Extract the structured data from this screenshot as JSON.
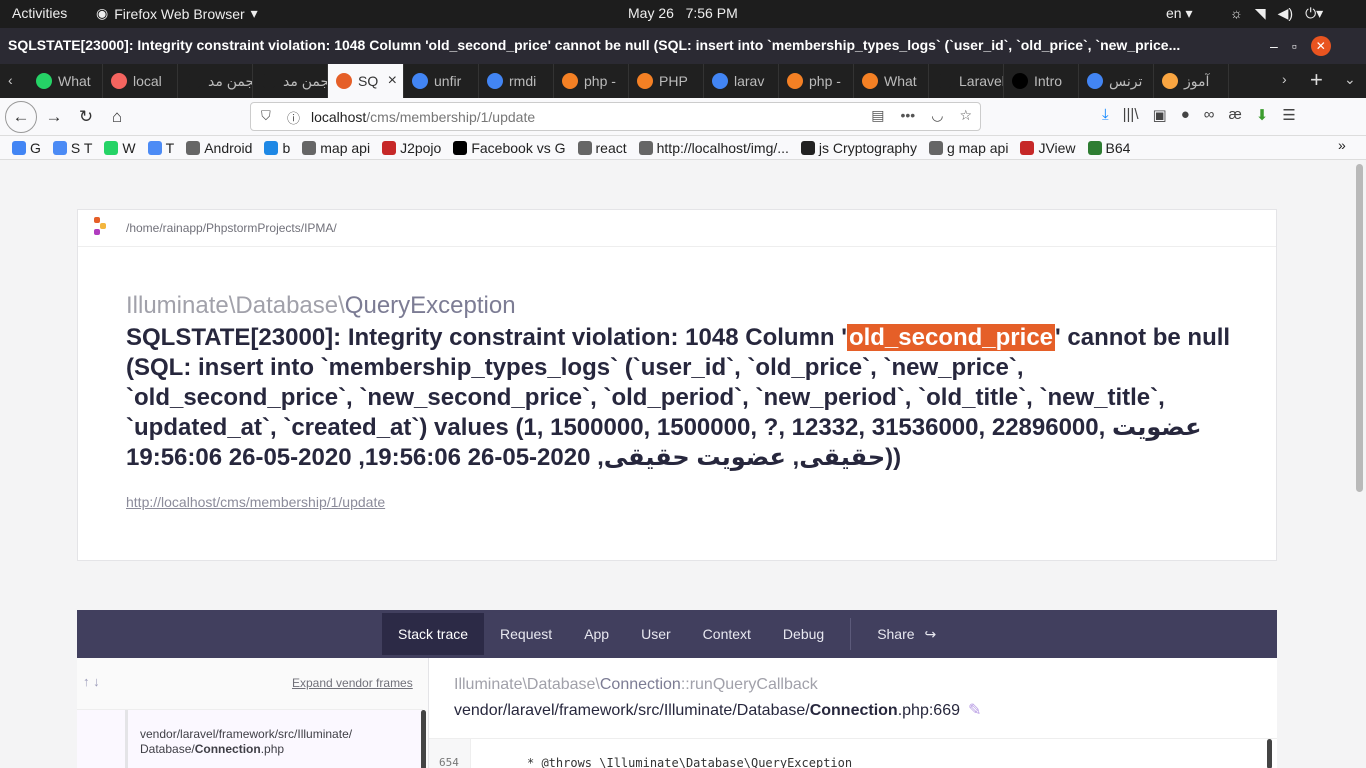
{
  "system": {
    "activities": "Activities",
    "app_name": "Firefox Web Browser",
    "date": "May 26",
    "time": "7:56 PM",
    "lang": "en"
  },
  "window": {
    "title": "SQLSTATE[23000]: Integrity constraint violation: 1048 Column 'old_second_price' cannot be null (SQL: insert into `membership_types_logs` (`user_id`, `old_price`, `new_price..."
  },
  "tabs": [
    {
      "label": "What",
      "icon": "whatsapp-icon",
      "color": "#25d366"
    },
    {
      "label": "local",
      "icon": "laravel-icon",
      "color": "#f4645f"
    },
    {
      "label": "انجمن مد",
      "icon": "blank-icon",
      "color": "#202020"
    },
    {
      "label": "انجمن مد",
      "icon": "blank-icon",
      "color": "#202020"
    },
    {
      "label": "SQ",
      "icon": "pencil-icon",
      "color": "#e55f28"
    },
    {
      "label": "unfir",
      "icon": "google-icon",
      "color": "#4285f4"
    },
    {
      "label": "rmdi",
      "icon": "google-icon",
      "color": "#4285f4"
    },
    {
      "label": "php -",
      "icon": "stackoverflow-icon",
      "color": "#f48024"
    },
    {
      "label": "PHP",
      "icon": "stackoverflow-icon",
      "color": "#f48024"
    },
    {
      "label": "larav",
      "icon": "google-icon",
      "color": "#4285f4"
    },
    {
      "label": "php -",
      "icon": "stackoverflow-icon",
      "color": "#f48024"
    },
    {
      "label": "What",
      "icon": "stackoverflow-icon",
      "color": "#f48024"
    },
    {
      "label": "Laravel-",
      "icon": "blank-icon",
      "color": "#202020"
    },
    {
      "label": "Intro",
      "icon": "medium-icon",
      "color": "#000000"
    },
    {
      "label": "ترنس",
      "icon": "google-icon",
      "color": "#4285f4"
    },
    {
      "label": "آموز",
      "icon": "joomla-icon",
      "color": "#f9a541"
    }
  ],
  "url": {
    "host": "localhost",
    "path": "/cms/membership/1/update"
  },
  "bookmarks": [
    {
      "label": "G",
      "icon": "google-icon",
      "color": "#4285f4"
    },
    {
      "label": "S T",
      "icon": "translate-icon",
      "color": "#4c8bf5"
    },
    {
      "label": "W",
      "icon": "whatsapp-icon",
      "color": "#25d366"
    },
    {
      "label": "T",
      "icon": "translate-icon",
      "color": "#4c8bf5"
    },
    {
      "label": "Android",
      "icon": "folder-icon",
      "color": "#666666"
    },
    {
      "label": "b",
      "icon": "bootstrap-icon",
      "color": "#1e88e5"
    },
    {
      "label": "map api",
      "icon": "folder-icon",
      "color": "#666666"
    },
    {
      "label": "J2pojo",
      "icon": "json-icon",
      "color": "#c62828"
    },
    {
      "label": "Facebook vs G",
      "icon": "medium-icon",
      "color": "#000000"
    },
    {
      "label": "react",
      "icon": "folder-icon",
      "color": "#666666"
    },
    {
      "label": "http://localhost/img/...",
      "icon": "globe-icon",
      "color": "#666666"
    },
    {
      "label": "js Cryptography",
      "icon": "github-icon",
      "color": "#222222"
    },
    {
      "label": "g map api",
      "icon": "globe-icon",
      "color": "#666666"
    },
    {
      "label": "JView",
      "icon": "jview-icon",
      "color": "#c62828"
    },
    {
      "label": "B64",
      "icon": "b64-icon",
      "color": "#2e7d32"
    }
  ],
  "page": {
    "project_path": "/home/rainapp/PhpstormProjects/IPMA/",
    "exception_ns": "Illuminate\\Database\\",
    "exception_class": "QueryException",
    "message_before": "SQLSTATE[23000]: Integrity constraint violation: 1048 Column '",
    "message_highlight": "old_second_price",
    "message_after": "' cannot be null (SQL: insert into `membership_types_logs` (`user_id`, `old_price`, `new_price`, `old_second_price`, `new_second_price`, `old_period`, `new_period`, `old_title`, `new_title`, `updated_at`, `created_at`) values (1, 1500000, 1500000, ?, 12332, 31536000, 22896000, عضویت حقیقی, عضویت حقیقی, 2020-05-26 19:56:06, 2020-05-26 19:56:06))",
    "request_url": "http://localhost/cms/membership/1/update"
  },
  "panel": {
    "tabs": [
      "Stack trace",
      "Request",
      "App",
      "User",
      "Context",
      "Debug"
    ],
    "share": "Share",
    "expand_vendor": "Expand vendor frames",
    "frame_dir": "vendor/laravel/framework/src/Illuminate/",
    "frame_dir2": "Database/",
    "frame_file": "Connection",
    "frame_ext": ".php",
    "fn_ns": "Illuminate\\Database\\",
    "fn_class": "Connection",
    "fn_method": "::runQueryCallback",
    "file_dir": "vendor/laravel/framework/src/Illuminate/Database/",
    "file_name": "Connection",
    "file_ext": ".php:669",
    "line_number": "654",
    "code_line": "* @throws \\Illuminate\\Database\\QueryException"
  }
}
